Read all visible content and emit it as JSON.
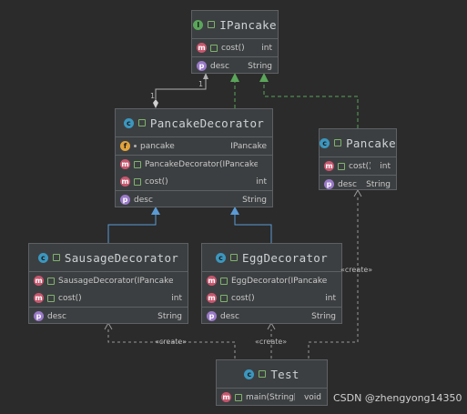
{
  "classes": {
    "ipancake": {
      "name": "IPancake",
      "methods": [
        {
          "name": "cost()",
          "type": "int"
        }
      ],
      "properties": [
        {
          "name": "desc",
          "type": "String"
        }
      ]
    },
    "pancake_decorator": {
      "name": "PancakeDecorator",
      "fields": [
        {
          "name": "pancake",
          "type": "IPancake"
        }
      ],
      "methods": [
        {
          "name": "PancakeDecorator(IPancake)",
          "type": ""
        },
        {
          "name": "cost()",
          "type": "int"
        }
      ],
      "properties": [
        {
          "name": "desc",
          "type": "String"
        }
      ]
    },
    "pancake": {
      "name": "Pancake",
      "methods": [
        {
          "name": "cost()",
          "type": "int"
        }
      ],
      "properties": [
        {
          "name": "desc",
          "type": "String"
        }
      ]
    },
    "sausage_decorator": {
      "name": "SausageDecorator",
      "methods": [
        {
          "name": "SausageDecorator(IPancake)",
          "type": ""
        },
        {
          "name": "cost()",
          "type": "int"
        }
      ],
      "properties": [
        {
          "name": "desc",
          "type": "String"
        }
      ]
    },
    "egg_decorator": {
      "name": "EggDecorator",
      "methods": [
        {
          "name": "EggDecorator(IPancake)",
          "type": ""
        },
        {
          "name": "cost()",
          "type": "int"
        }
      ],
      "properties": [
        {
          "name": "desc",
          "type": "String"
        }
      ]
    },
    "test": {
      "name": "Test",
      "methods": [
        {
          "name": "main(String[])",
          "type": "void"
        }
      ]
    }
  },
  "labels": {
    "mult_top": "1",
    "mult_bottom": "1",
    "create_pancake": "«create»",
    "create_sausage": "«create»",
    "create_egg": "«create»"
  },
  "icons": {
    "class": "c",
    "interface": "I",
    "method": "m",
    "field": "f",
    "property": "p"
  },
  "watermark": "CSDN @zhengyong14350",
  "colors": {
    "background": "#2b2b2b",
    "box": "#3c3f41",
    "realization": "#5aa65a",
    "generalization": "#5b9bd5",
    "dependency": "#9a9a9a"
  }
}
